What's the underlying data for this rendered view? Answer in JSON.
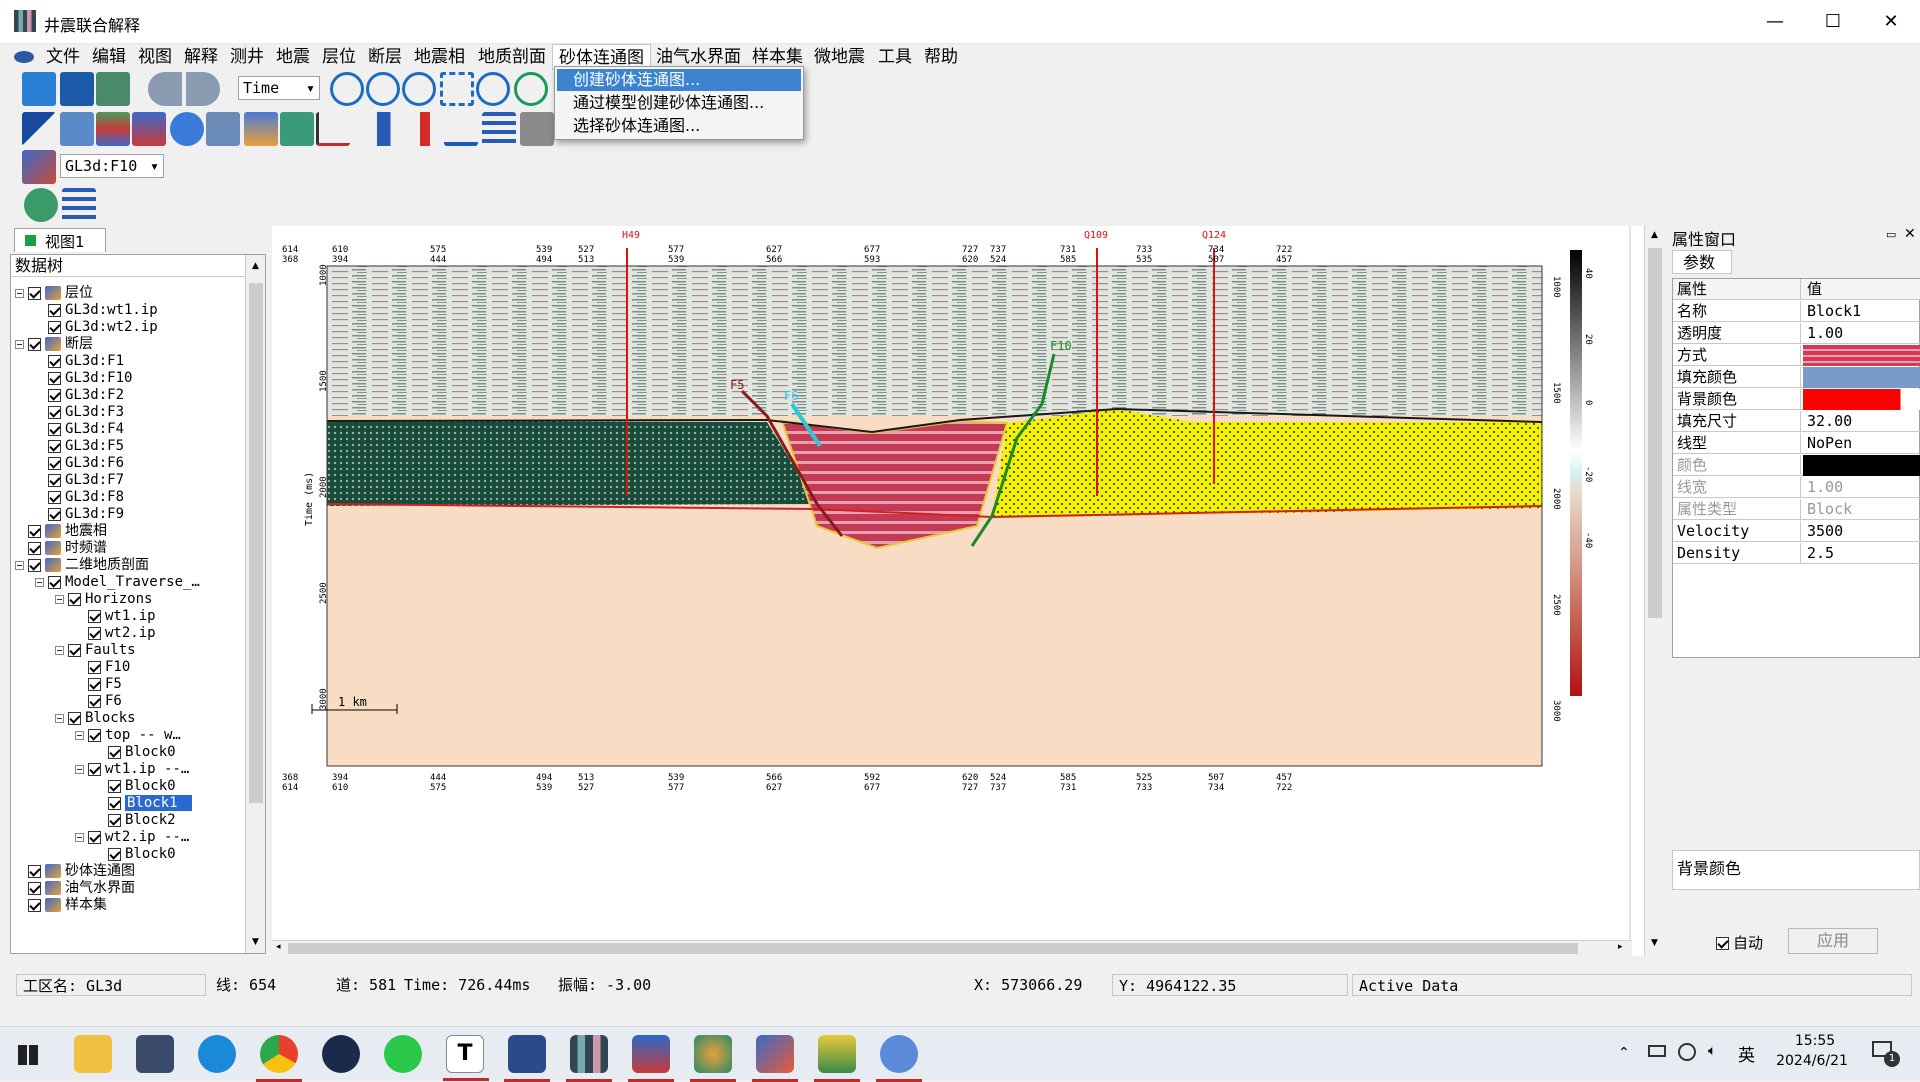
{
  "app": {
    "title": "井震联合解释"
  },
  "window_controls": {
    "minimize": "—",
    "maximize": "☐",
    "close": "✕"
  },
  "menu": [
    "文件",
    "编辑",
    "视图",
    "解释",
    "测井",
    "地震",
    "层位",
    "断层",
    "地震相",
    "地质剖面",
    "砂体连通图",
    "油气水界面",
    "样本集",
    "微地震",
    "工具",
    "帮助"
  ],
  "dropdown": {
    "items": [
      "创建砂体连通图...",
      "通过模型创建砂体连通图...",
      "选择砂体连通图..."
    ]
  },
  "toolbar": {
    "time_select": "Time",
    "layer_select": "GL3d:F10"
  },
  "view_tab": {
    "label": "视图1"
  },
  "tree": {
    "title": "数据树",
    "nodes": [
      {
        "label": "层位",
        "level": 0,
        "exp": true,
        "icon": "horizon-icon"
      },
      {
        "label": "GL3d:wt1.ip",
        "level": 1
      },
      {
        "label": "GL3d:wt2.ip",
        "level": 1
      },
      {
        "label": "断层",
        "level": 0,
        "exp": true,
        "icon": "fault-icon"
      },
      {
        "label": "GL3d:F1",
        "level": 1
      },
      {
        "label": "GL3d:F10",
        "level": 1
      },
      {
        "label": "GL3d:F2",
        "level": 1
      },
      {
        "label": "GL3d:F3",
        "level": 1
      },
      {
        "label": "GL3d:F4",
        "level": 1
      },
      {
        "label": "GL3d:F5",
        "level": 1
      },
      {
        "label": "GL3d:F6",
        "level": 1
      },
      {
        "label": "GL3d:F7",
        "level": 1
      },
      {
        "label": "GL3d:F8",
        "level": 1
      },
      {
        "label": "GL3d:F9",
        "level": 1
      },
      {
        "label": "地震相",
        "level": 0,
        "icon": "facies-icon"
      },
      {
        "label": "时频谱",
        "level": 0,
        "icon": "spectrum-icon"
      },
      {
        "label": "二维地质剖面",
        "level": 0,
        "exp": true,
        "icon": "section-icon"
      },
      {
        "label": "Model_Traverse_…",
        "level": 1,
        "exp": true
      },
      {
        "label": "Horizons",
        "level": 2,
        "exp": true
      },
      {
        "label": "wt1.ip",
        "level": 3
      },
      {
        "label": "wt2.ip",
        "level": 3
      },
      {
        "label": "Faults",
        "level": 2,
        "exp": true
      },
      {
        "label": "F10",
        "level": 3
      },
      {
        "label": "F5",
        "level": 3
      },
      {
        "label": "F6",
        "level": 3
      },
      {
        "label": "Blocks",
        "level": 2,
        "exp": true
      },
      {
        "label": "top  -- w…",
        "level": 3,
        "exp": true
      },
      {
        "label": "Block0",
        "level": 4
      },
      {
        "label": "wt1.ip --…",
        "level": 3,
        "exp": true
      },
      {
        "label": "Block0",
        "level": 4
      },
      {
        "label": "Block1",
        "level": 4,
        "selected": true
      },
      {
        "label": "Block2",
        "level": 4
      },
      {
        "label": "wt2.ip --…",
        "level": 3,
        "exp": true
      },
      {
        "label": "Block0",
        "level": 4
      },
      {
        "label": "砂体连通图",
        "level": 0,
        "icon": "sand-map-icon"
      },
      {
        "label": "油气水界面",
        "level": 0,
        "icon": "fluid-contact-icon"
      },
      {
        "label": "样本集",
        "level": 0,
        "icon": "sample-set-icon"
      }
    ]
  },
  "section": {
    "wells": [
      "H49",
      "Q109",
      "Q124"
    ],
    "top_axis_row1": [
      "614",
      "610",
      "575",
      "539",
      "527",
      "577",
      "627",
      "677",
      "727",
      "737",
      "731",
      "733",
      "734",
      "722"
    ],
    "top_axis_row2": [
      "368",
      "394",
      "444",
      "494",
      "513",
      "539",
      "566",
      "593",
      "620",
      "524",
      "585",
      "535",
      "507",
      "457"
    ],
    "bottom_axis_row1": [
      "368",
      "394",
      "444",
      "494",
      "513",
      "539",
      "566",
      "592",
      "620",
      "524",
      "585",
      "525",
      "507",
      "457"
    ],
    "bottom_axis_row2": [
      "614",
      "610",
      "575",
      "539",
      "527",
      "577",
      "627",
      "677",
      "727",
      "737",
      "731",
      "733",
      "734",
      "722"
    ],
    "time_ticks": [
      "1000",
      "1500",
      "2000",
      "2500",
      "3000"
    ],
    "time_label": "Time (ms)",
    "colorbar_ticks": [
      "40",
      "20",
      "0",
      "-20",
      "-40"
    ],
    "faults": [
      "F5",
      "F6",
      "F10"
    ],
    "scale": "1 km"
  },
  "properties": {
    "title": "属性窗口",
    "tab": "参数",
    "header": [
      "属性",
      "值"
    ],
    "rows": [
      {
        "k": "名称",
        "v": "Block1"
      },
      {
        "k": "透明度",
        "v": "1.00"
      },
      {
        "k": "方式",
        "v": ""
      },
      {
        "k": "填充颜色",
        "v": ""
      },
      {
        "k": "背景颜色",
        "v": ""
      },
      {
        "k": "填充尺寸",
        "v": "32.00"
      },
      {
        "k": "线型",
        "v": "NoPen"
      },
      {
        "k": "颜色",
        "v": "",
        "disabled": true
      },
      {
        "k": "线宽",
        "v": "1.00",
        "disabled": true
      },
      {
        "k": "属性类型",
        "v": "Block",
        "disabled": true
      },
      {
        "k": "Velocity",
        "v": "3500"
      },
      {
        "k": "Density",
        "v": "2.5"
      }
    ],
    "description": "背景颜色",
    "auto_label": "自动",
    "apply_label": "应用"
  },
  "status": {
    "workarea": "工区名: GL3d",
    "line": "线: 654",
    "trace": "道: 581",
    "time": "Time: 726.44ms",
    "amp": "振幅: -3.00",
    "x": "X: 573066.29",
    "y": "Y: 4964122.35",
    "mode": "Active Data"
  },
  "taskbar": {
    "time": "15:55",
    "date": "2024/6/21",
    "ime": "英",
    "notif": "1"
  },
  "colors": {
    "fill_red": "#d43a57",
    "fill_blue": "#7a9bc8",
    "bg_red": "#ff0000",
    "line_black": "#000000"
  }
}
